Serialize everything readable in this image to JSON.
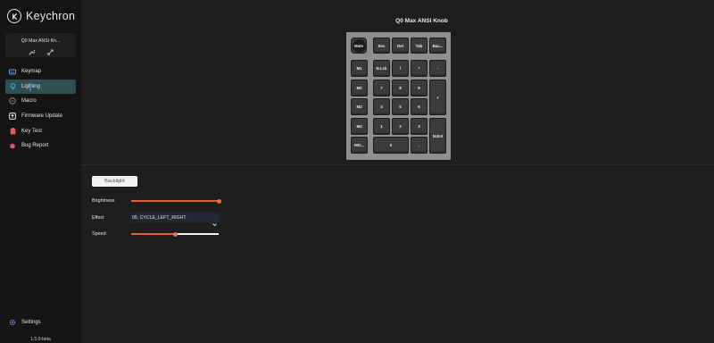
{
  "app": {
    "name": "Keychron",
    "version": "1.5.0-beta"
  },
  "device": {
    "name": "Q0 Max ANSI Kn..."
  },
  "sidebar": {
    "items": [
      {
        "label": "Keymap",
        "icon": "keyboard-icon",
        "color": "#4aa3d8"
      },
      {
        "label": "Lighting",
        "icon": "bulb-icon",
        "color": "#4aa3d8",
        "active": true
      },
      {
        "label": "Macro",
        "icon": "macro-icon",
        "color": "#888888"
      },
      {
        "label": "Firmware Update",
        "icon": "upload-icon",
        "color": "#e8e8e8"
      },
      {
        "label": "Key Test",
        "icon": "clipboard-icon",
        "color": "#e05555"
      },
      {
        "label": "Bug Report",
        "icon": "bug-icon",
        "color": "#e0508a"
      }
    ],
    "settings_label": "Settings",
    "settings_color": "#a068e0"
  },
  "keyboard": {
    "title": "Q0 Max ANSI Knob",
    "knob_label": "Mute",
    "keys": [
      {
        "label": "Esc"
      },
      {
        "label": "Del"
      },
      {
        "label": "Tab"
      },
      {
        "label": "Bac..."
      },
      {
        "label": "M1"
      },
      {
        "label": "N.Lck"
      },
      {
        "label": "/"
      },
      {
        "label": "*"
      },
      {
        "label": "-"
      },
      {
        "label": "M2"
      },
      {
        "label": "7"
      },
      {
        "label": "8"
      },
      {
        "label": "9"
      },
      {
        "label": "+"
      },
      {
        "label": "M3"
      },
      {
        "label": "4"
      },
      {
        "label": "5"
      },
      {
        "label": "6"
      },
      {
        "label": "M4"
      },
      {
        "label": "1"
      },
      {
        "label": "2"
      },
      {
        "label": "3"
      },
      {
        "label": "N.Ent"
      },
      {
        "label": "MO..."
      },
      {
        "label": "0"
      },
      {
        "label": "."
      }
    ]
  },
  "lighting": {
    "tab_label": "Backlight",
    "brightness_label": "Brightness",
    "brightness_value": 1.0,
    "effect_label": "Effect",
    "effect_value": "05. CYCLE_LEFT_RIGHT",
    "speed_label": "Speed",
    "speed_value": 0.5,
    "accent": "#e0623d"
  }
}
